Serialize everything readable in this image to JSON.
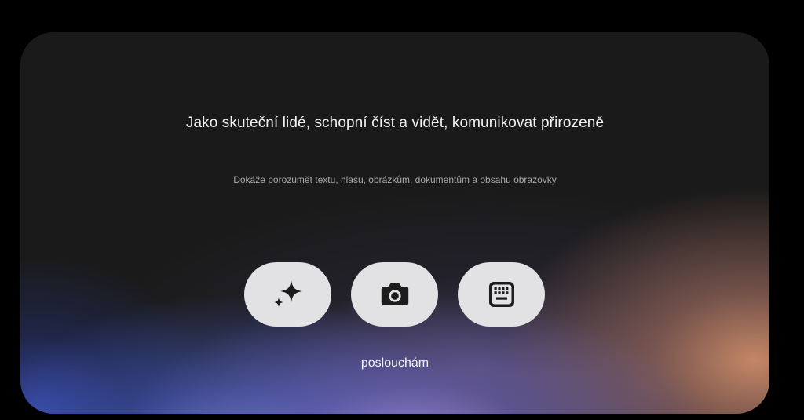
{
  "card": {
    "headline": "Jako skuteční lidé, schopní číst a vidět, komunikovat přirozeně",
    "subline": "Dokáže porozumět textu, hlasu, obrázkům, dokumentům a obsahu obrazovky"
  },
  "actions": [
    {
      "icon": "sparkle-icon"
    },
    {
      "icon": "camera-icon"
    },
    {
      "icon": "keyboard-icon"
    }
  ],
  "status": {
    "label": "poslouchám"
  },
  "colors": {
    "page_background": "#000000",
    "card_background": "#1a1a1a",
    "button_background": "#e2e1e4",
    "icon_color": "#1c1c1c",
    "glow_blue": "#5f7ddc",
    "glow_violet": "#a08cdc",
    "glow_peach": "#cd8c69"
  }
}
